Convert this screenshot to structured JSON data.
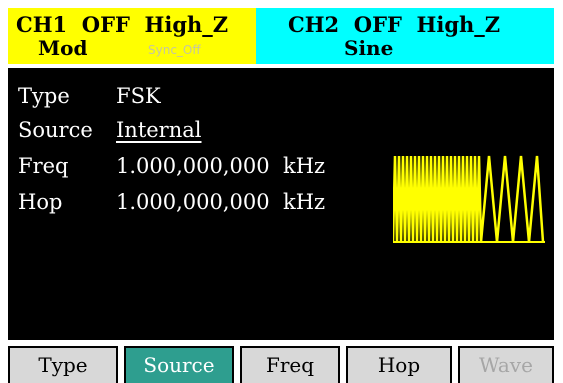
{
  "channels": {
    "ch1": {
      "label": "CH1  OFF  High_Z",
      "mode": "Mod",
      "sync": "Sync_Off",
      "color": "#ffff00"
    },
    "ch2": {
      "label": "CH2  OFF  High_Z",
      "mode": "Sine",
      "color": "#00ffff"
    }
  },
  "params": [
    {
      "label": "Type",
      "value": "FSK"
    },
    {
      "label": "Source",
      "value": "Internal"
    },
    {
      "label": "Freq",
      "value": "1.000,000,000  kHz"
    },
    {
      "label": "Hop",
      "value": "1.000,000,000  kHz"
    }
  ],
  "waveform": {
    "type": "FSK",
    "color": "#ffff00"
  },
  "softkeys": [
    {
      "label": "Type",
      "state": "normal"
    },
    {
      "label": "Source",
      "state": "active"
    },
    {
      "label": "Freq",
      "state": "normal"
    },
    {
      "label": "Hop",
      "state": "normal"
    },
    {
      "label": "Wave",
      "state": "disabled"
    }
  ],
  "colors": {
    "softkey_active": "#2e9e8f",
    "softkey_bg": "#d8d8d8",
    "softkey_disabled_text": "#a6a6a6",
    "main_bg": "#000000"
  }
}
